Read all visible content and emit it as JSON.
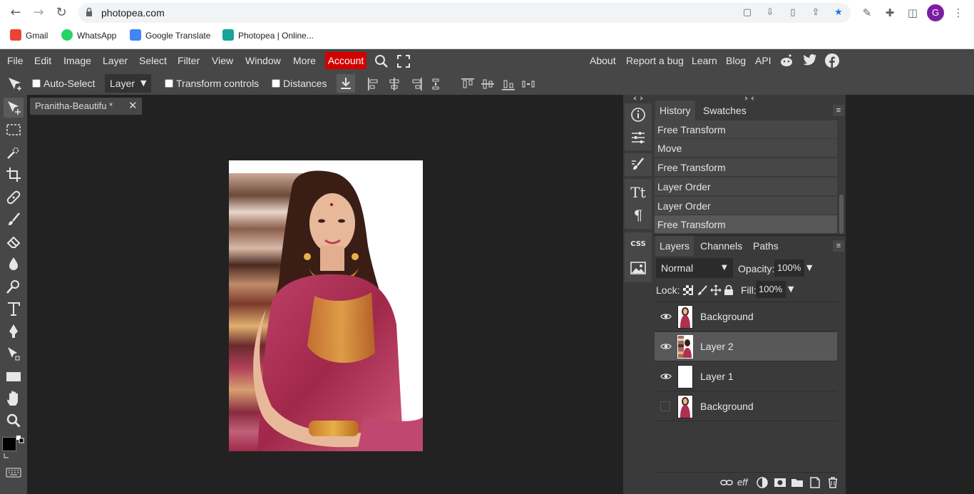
{
  "browser": {
    "url": "photopea.com",
    "profile_initial": "G",
    "bookmarks": [
      {
        "label": "Gmail",
        "color": "#ea4335"
      },
      {
        "label": "WhatsApp",
        "color": "#25d366"
      },
      {
        "label": "Google Translate",
        "color": "#4285f4"
      },
      {
        "label": "Photopea | Online...",
        "color": "#18a497"
      }
    ]
  },
  "menu": {
    "items": [
      "File",
      "Edit",
      "Image",
      "Layer",
      "Select",
      "Filter",
      "View",
      "Window",
      "More"
    ],
    "account": "Account",
    "right": [
      "About",
      "Report a bug",
      "Learn",
      "Blog",
      "API"
    ]
  },
  "options": {
    "auto_select": "Auto-Select",
    "auto_select_value": "Layer",
    "transform_controls": "Transform controls",
    "distances": "Distances"
  },
  "document": {
    "tab_title": "Pranitha-Beautifu",
    "tab_suffix": "*"
  },
  "history_panel": {
    "tabs": [
      "History",
      "Swatches"
    ],
    "items": [
      "Free Transform",
      "Move",
      "Free Transform",
      "Layer Order",
      "Layer Order",
      "Free Transform"
    ]
  },
  "layers_panel": {
    "tabs": [
      "Layers",
      "Channels",
      "Paths"
    ],
    "blend_mode": "Normal",
    "opacity_label": "Opacity:",
    "opacity": "100%",
    "lock_label": "Lock:",
    "fill_label": "Fill:",
    "fill": "100%",
    "layers": [
      {
        "name": "Background",
        "visible": true,
        "selected": false
      },
      {
        "name": "Layer 2",
        "visible": true,
        "selected": true
      },
      {
        "name": "Layer 1",
        "visible": true,
        "selected": false
      },
      {
        "name": "Background",
        "visible": false,
        "selected": false
      }
    ]
  },
  "colors": {
    "accent_account": "#d30000",
    "panel_bg": "#3a3a3a",
    "workspace_bg": "#222222",
    "foreground": "#000000",
    "background_color": "#ffffff"
  }
}
